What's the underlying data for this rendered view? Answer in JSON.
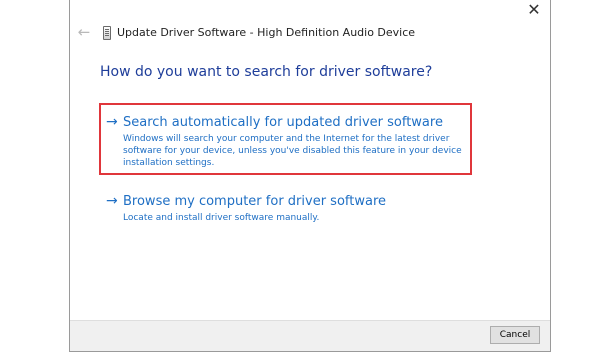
{
  "window": {
    "title": "Update Driver Software - High Definition Audio Device",
    "close_glyph": "✕",
    "back_glyph": "←"
  },
  "main": {
    "heading": "How do you want to search for driver software?",
    "arrow_glyph": "→",
    "options": [
      {
        "title": "Search automatically for updated driver software",
        "description": "Windows will search your computer and the Internet for the latest driver software for your device, unless you've disabled this feature in your device installation settings."
      },
      {
        "title": "Browse my computer for driver software",
        "description": "Locate and install driver software manually."
      }
    ]
  },
  "footer": {
    "cancel_label": "Cancel"
  },
  "colors": {
    "link_blue": "#1f6fc4",
    "heading_blue": "#1f3e9a",
    "highlight_red": "#e0363b",
    "footer_gray": "#f0f0f0"
  }
}
